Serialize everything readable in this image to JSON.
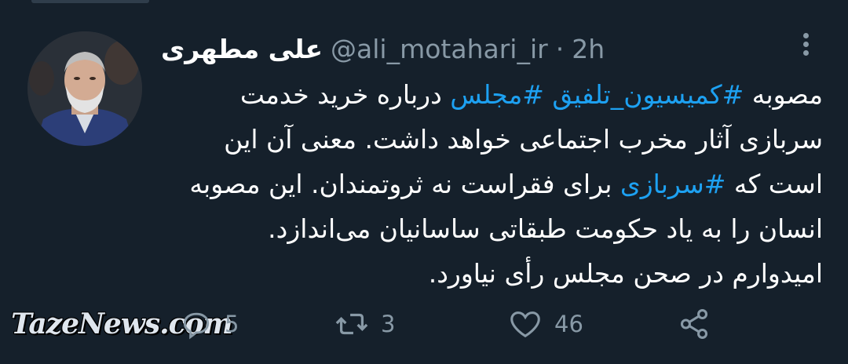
{
  "tweet": {
    "display_name": "علی مطهری",
    "handle": "@ali_motahari_ir",
    "separator": "·",
    "time": "2h",
    "body": {
      "lines": [
        [
          {
            "type": "text",
            "text": "مصوبه "
          },
          {
            "type": "hashtag",
            "text": "#کمیسیون_تلفیق"
          },
          {
            "type": "text",
            "text": " "
          },
          {
            "type": "hashtag",
            "text": "#مجلس"
          },
          {
            "type": "text",
            "text": " درباره خرید خدمت"
          }
        ],
        [
          {
            "type": "text",
            "text": "سربازی آثار مخرب اجتماعی خواهد داشت. معنی آن این"
          }
        ],
        [
          {
            "type": "text",
            "text": "است که "
          },
          {
            "type": "hashtag",
            "text": "#سربازی"
          },
          {
            "type": "text",
            "text": " برای فقراست نه ثروتمندان. این مصوبه"
          }
        ],
        [
          {
            "type": "text",
            "text": "انسان را به یاد حکومت طبقاتی ساسانیان می‌اندازد."
          }
        ],
        [
          {
            "type": "text",
            "text": "امیدوارم در صحن مجلس رأی نیاورد."
          }
        ]
      ]
    }
  },
  "actions": {
    "reply": {
      "icon": "reply-icon",
      "count": "5"
    },
    "retweet": {
      "icon": "retweet-icon",
      "count": "3"
    },
    "like": {
      "icon": "heart-icon",
      "count": "46"
    },
    "share": {
      "icon": "share-icon"
    }
  },
  "watermark": "TazeNews.com",
  "colors": {
    "background": "#15202b",
    "text": "#ffffff",
    "secondary": "#8899a6",
    "hashtag": "#1da1f2"
  }
}
